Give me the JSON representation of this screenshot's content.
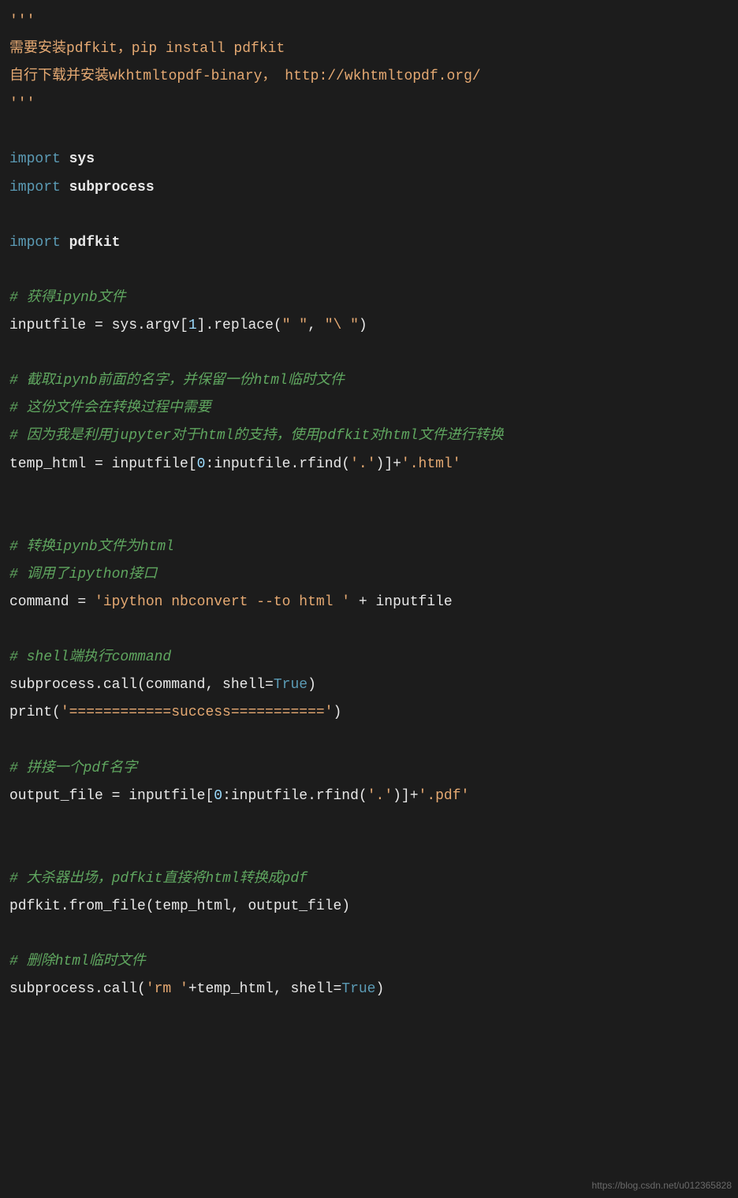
{
  "code": {
    "lines": [
      {
        "type": "string",
        "text": "'''"
      },
      {
        "type": "string",
        "text": "需要安装pdfkit，pip install pdfkit"
      },
      {
        "type": "string",
        "text": "自行下载并安装wkhtmltopdf-binary， http://wkhtmltopdf.org/"
      },
      {
        "type": "string",
        "text": "'''"
      },
      {
        "type": "blank",
        "text": ""
      },
      {
        "type": "import",
        "keyword": "import",
        "module": "sys"
      },
      {
        "type": "import",
        "keyword": "import",
        "module": "subprocess"
      },
      {
        "type": "blank",
        "text": ""
      },
      {
        "type": "import",
        "keyword": "import",
        "module": "pdfkit"
      },
      {
        "type": "blank",
        "text": ""
      },
      {
        "type": "comment",
        "text": "# 获得ipynb文件"
      },
      {
        "type": "assign1",
        "var": "inputfile",
        "eq": " = ",
        "obj": "sys.argv[",
        "idx": "1",
        "mid": "].replace(",
        "s1": "\" \"",
        "comma": ", ",
        "s2": "\"\\ \"",
        "end": ")"
      },
      {
        "type": "blank",
        "text": ""
      },
      {
        "type": "comment",
        "text": "# 截取ipynb前面的名字，并保留一份html临时文件"
      },
      {
        "type": "comment",
        "text": "# 这份文件会在转换过程中需要"
      },
      {
        "type": "comment",
        "text": "# 因为我是利用jupyter对于html的支持，使用pdfkit对html文件进行转换"
      },
      {
        "type": "assign2",
        "var": "temp_html",
        "eq": " = ",
        "p1": "inputfile[",
        "n0": "0",
        "p2": ":inputfile.rfind(",
        "s1": "'.'",
        "p3": ")]+",
        "s2": "'.html'"
      },
      {
        "type": "blank",
        "text": ""
      },
      {
        "type": "blank",
        "text": ""
      },
      {
        "type": "comment",
        "text": "# 转换ipynb文件为html"
      },
      {
        "type": "comment",
        "text": "# 调用了ipython接口"
      },
      {
        "type": "assign3",
        "var": "command",
        "eq": " = ",
        "s1": "'ipython nbconvert --to html '",
        "plus": " + ",
        "v2": "inputfile"
      },
      {
        "type": "blank",
        "text": ""
      },
      {
        "type": "comment",
        "text": "# shell端执行command"
      },
      {
        "type": "call1",
        "p1": "subprocess.call(command, shell=",
        "b": "True",
        "p2": ")"
      },
      {
        "type": "print1",
        "p1": "print(",
        "s1": "'============success==========='",
        "p2": ")"
      },
      {
        "type": "blank",
        "text": ""
      },
      {
        "type": "comment",
        "text": "# 拼接一个pdf名字"
      },
      {
        "type": "assign4",
        "var": "output_file",
        "eq": " = ",
        "p1": "inputfile[",
        "n0": "0",
        "p2": ":inputfile.rfind(",
        "s1": "'.'",
        "p3": ")]+",
        "s2": "'.pdf'"
      },
      {
        "type": "blank",
        "text": ""
      },
      {
        "type": "blank",
        "text": ""
      },
      {
        "type": "comment",
        "text": "# 大杀器出场，pdfkit直接将html转换成pdf"
      },
      {
        "type": "plain",
        "text": "pdfkit.from_file(temp_html, output_file)"
      },
      {
        "type": "blank",
        "text": ""
      },
      {
        "type": "comment",
        "text": "# 删除html临时文件"
      },
      {
        "type": "call2",
        "p1": "subprocess.call(",
        "s1": "'rm '",
        "p2": "+temp_html, shell=",
        "b": "True",
        "p3": ")"
      }
    ]
  },
  "watermark": "https://blog.csdn.net/u012365828"
}
